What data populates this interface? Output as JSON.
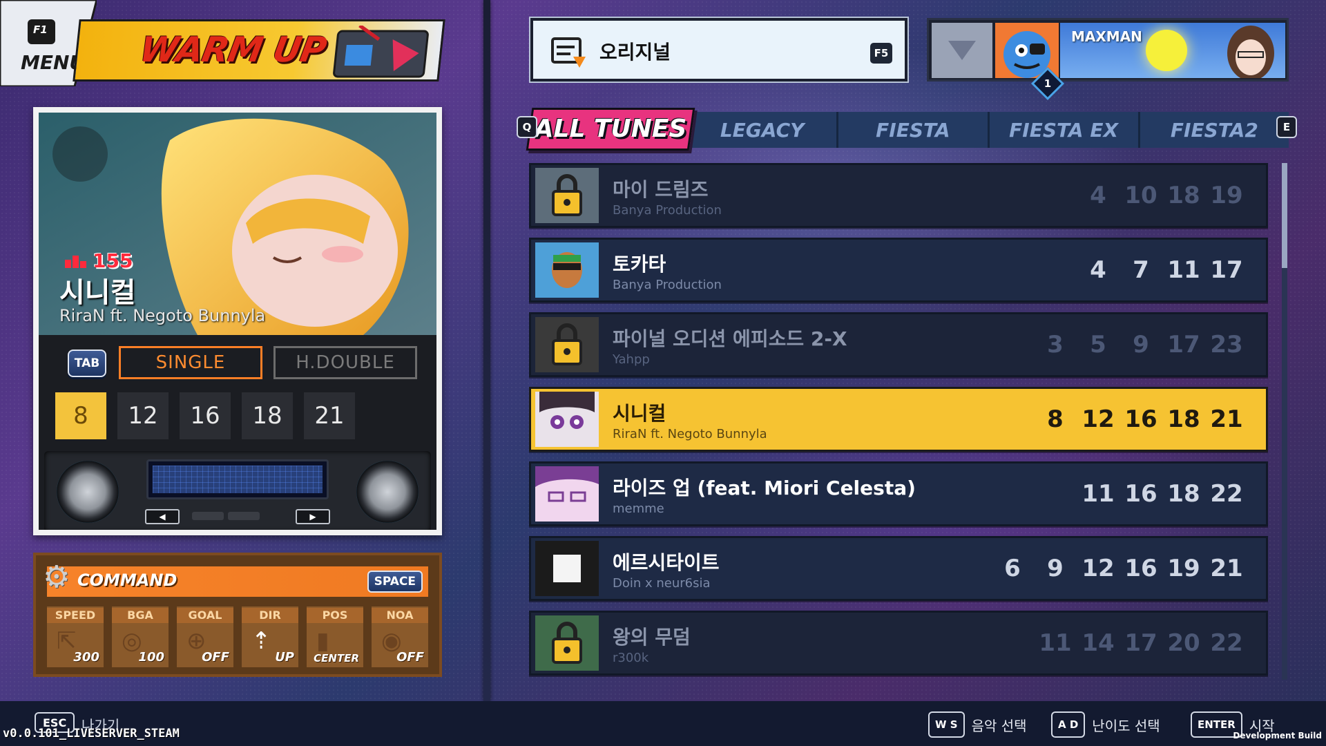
{
  "menu": {
    "key": "F1",
    "label": "MENU"
  },
  "banner": {
    "title": "WARM UP"
  },
  "selected_song": {
    "level_badge": "155",
    "title": "시니컬",
    "artist": "RiraN ft. Negoto Bunnyla",
    "tab_key": "TAB",
    "modes": [
      "SINGLE",
      "H.DOUBLE"
    ],
    "active_mode": "SINGLE",
    "difficulties": [
      "8",
      "12",
      "16",
      "18",
      "21"
    ],
    "active_difficulty": "8"
  },
  "command": {
    "title": "COMMAND",
    "key": "SPACE",
    "items": [
      {
        "label": "SPEED",
        "value": "300"
      },
      {
        "label": "BGA",
        "value": "100"
      },
      {
        "label": "GOAL",
        "value": "OFF"
      },
      {
        "label": "DIR",
        "value": "UP"
      },
      {
        "label": "POS",
        "value": "CENTER"
      },
      {
        "label": "NOA",
        "value": "OFF"
      }
    ]
  },
  "category": {
    "label": "오리지널",
    "key": "F5"
  },
  "profile": {
    "name": "MAXMAN",
    "rank": "1"
  },
  "tabs": {
    "left_key": "Q",
    "right_key": "E",
    "active": "ALL TUNES",
    "items": [
      "LEGACY",
      "FIESTA",
      "FIESTA EX",
      "FIESTA2"
    ]
  },
  "songs": [
    {
      "title": "마이 드림즈",
      "artist": "Banya Production",
      "levels": [
        "4",
        "10",
        "18",
        "19"
      ],
      "locked": true,
      "selected": false
    },
    {
      "title": "토카타",
      "artist": "Banya Production",
      "levels": [
        "4",
        "7",
        "11",
        "17"
      ],
      "locked": false,
      "selected": false
    },
    {
      "title": "파이널 오디션 에피소드 2-X",
      "artist": "Yahpp",
      "levels": [
        "3",
        "5",
        "9",
        "17",
        "23"
      ],
      "locked": true,
      "selected": false
    },
    {
      "title": "시니컬",
      "artist": "RiraN ft. Negoto Bunnyla",
      "levels": [
        "8",
        "12",
        "16",
        "18",
        "21"
      ],
      "locked": false,
      "selected": true
    },
    {
      "title": "라이즈 업 (feat. Miori Celesta)",
      "artist": "memme",
      "levels": [
        "11",
        "16",
        "18",
        "22"
      ],
      "locked": false,
      "selected": false
    },
    {
      "title": "에르시타이트",
      "artist": "Doin x neur6sia",
      "levels": [
        "6",
        "9",
        "12",
        "16",
        "19",
        "21"
      ],
      "locked": false,
      "selected": false
    },
    {
      "title": "왕의 무덤",
      "artist": "r300k",
      "levels": [
        "11",
        "14",
        "17",
        "20",
        "22"
      ],
      "locked": true,
      "selected": false
    }
  ],
  "footer": {
    "esc_key": "ESC",
    "esc_label": "나가기",
    "version": "v0.0.101_LIVESERVER_STEAM",
    "hints": [
      {
        "keys": "W S",
        "label": "음악 선택"
      },
      {
        "keys": "A D",
        "label": "난이도 선택"
      },
      {
        "keys": "ENTER",
        "label": "시작"
      }
    ],
    "build": "Development Build"
  },
  "colors": {
    "accent_pink": "#e8337f",
    "selected_row": "#f6c332",
    "single_orange": "#ff7f26"
  }
}
